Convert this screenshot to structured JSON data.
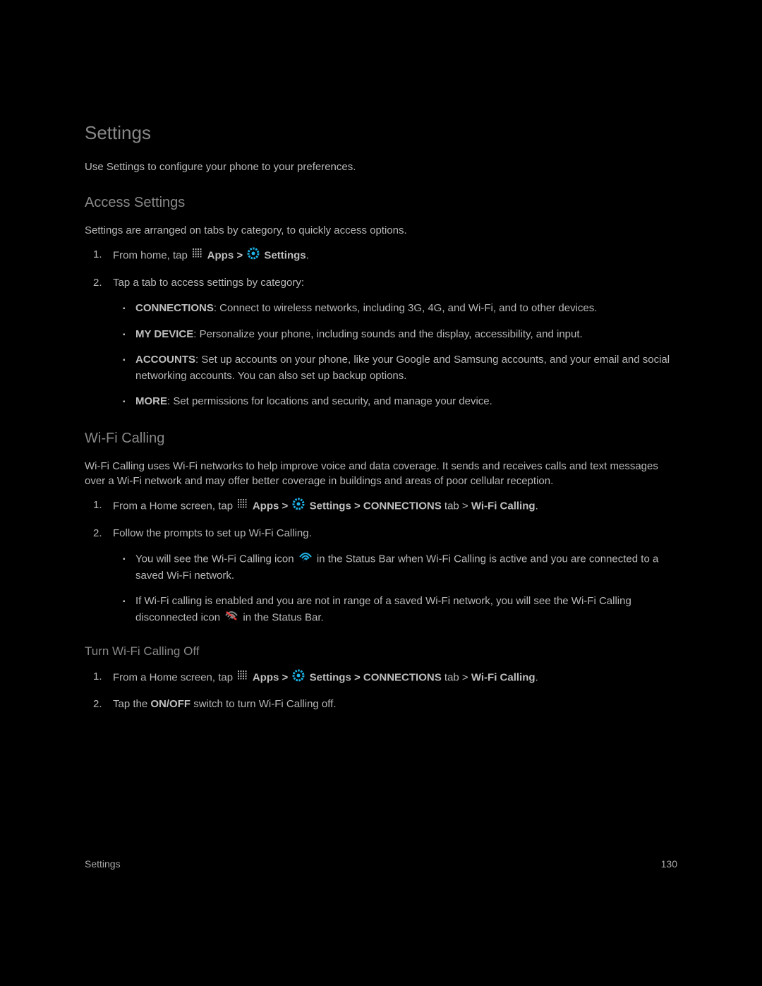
{
  "page": {
    "title": "Settings",
    "intro": "Use Settings to configure your phone to your preferences.",
    "footer_left": "Settings",
    "footer_right": "130"
  },
  "access_settings": {
    "heading": "Access Settings",
    "intro": "Settings are arranged on tabs by category, to quickly access options.",
    "step1_pre": "From home, tap ",
    "apps_label": " Apps > ",
    "settings_label": " Settings",
    "step1_post": ".",
    "step2": "Tap a tab to access settings by category:",
    "tabs": {
      "connections_label": "CONNECTIONS",
      "connections_text": ": Connect to wireless networks, including 3G, 4G, and Wi-Fi, and to other devices.",
      "mydevice_label": "MY DEVICE",
      "mydevice_text": ": Personalize your phone, including sounds and the display, accessibility, and input.",
      "accounts_label": "ACCOUNTS",
      "accounts_text": ": Set up accounts on your phone, like your Google and Samsung accounts, and your email and social networking accounts. You can also set up backup options.",
      "more_label": "MORE",
      "more_text": ": Set permissions for locations and security, and manage your device."
    }
  },
  "wifi_calling": {
    "heading": "Wi-Fi Calling",
    "intro": "Wi-Fi Calling uses Wi-Fi networks to help improve voice and data coverage. It sends and receives calls and text messages over a Wi-Fi network and may offer better coverage in buildings and areas of poor cellular reception.",
    "step1_pre": "From a Home screen, tap ",
    "apps_label": " Apps > ",
    "settings_label": " Settings > CONNECTIONS",
    "step1_tab": " tab > ",
    "step1_wifi": "Wi-Fi Calling",
    "step1_post": ".",
    "step2": "Follow the prompts to set up Wi-Fi Calling.",
    "note1_pre": "You will see the Wi-Fi Calling icon ",
    "note1_post": " in the Status Bar when Wi-Fi Calling is active and you are connected to a saved Wi-Fi network.",
    "note2_pre": "If Wi-Fi calling is enabled and you are not in range of a saved Wi-Fi network, you will see the Wi-Fi Calling disconnected icon ",
    "note2_post": " in the Status Bar."
  },
  "turn_off": {
    "heading": "Turn Wi-Fi Calling Off",
    "step1_pre": "From a Home screen, tap ",
    "apps_label": " Apps > ",
    "settings_label": " Settings > CONNECTIONS",
    "step1_tab": " tab > ",
    "step1_wifi": "Wi-Fi Calling",
    "step1_post": ".",
    "step2_pre": "Tap the ",
    "step2_bold": "ON/OFF",
    "step2_post": " switch to turn Wi-Fi Calling off."
  }
}
